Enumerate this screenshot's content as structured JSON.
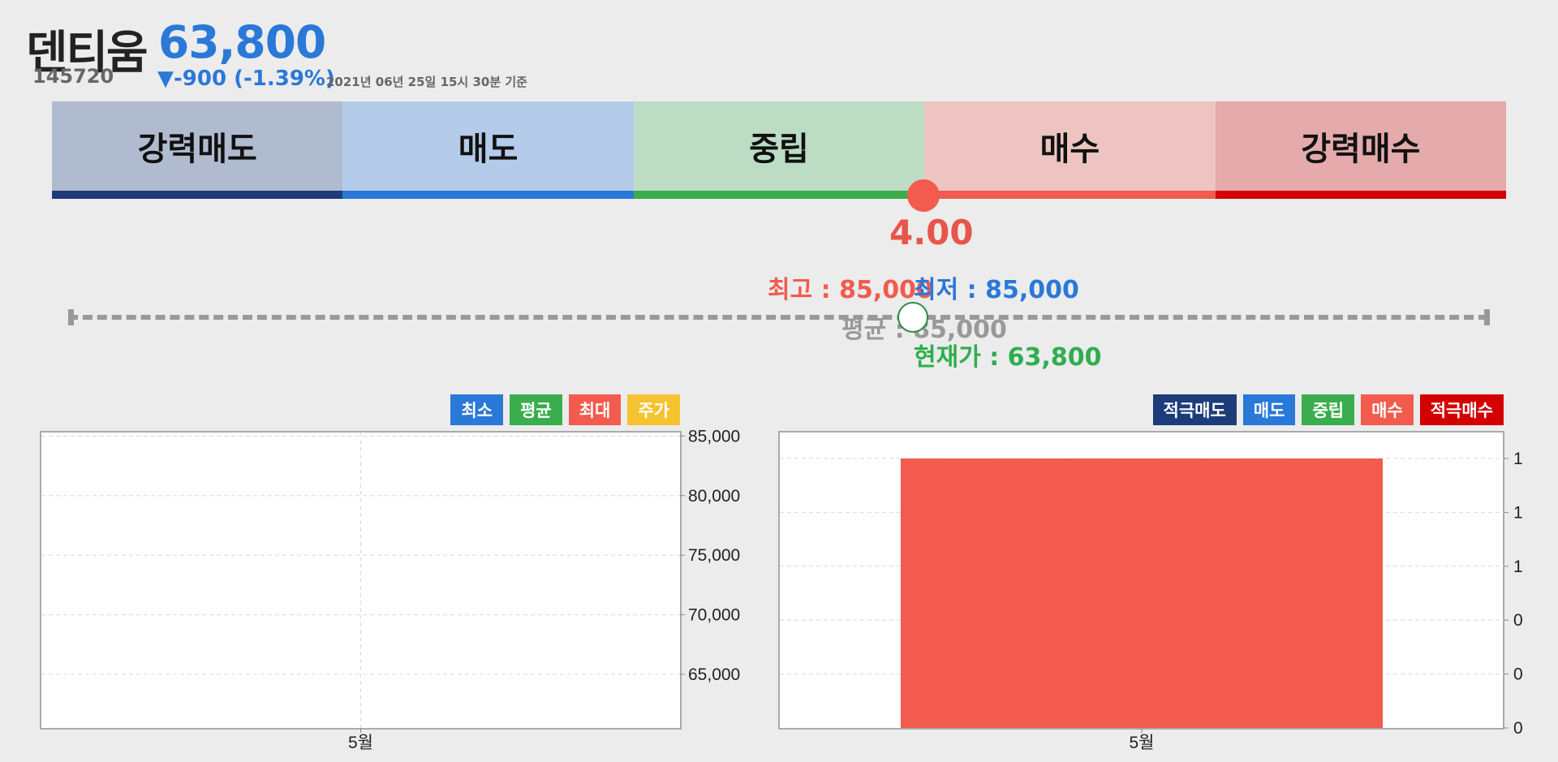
{
  "header": {
    "stock_name": "덴티움",
    "stock_code": "145720",
    "price": "63,800",
    "change": "▼-900 (-1.39%)",
    "date": "2021년 06년 25일 15시 30분 기준"
  },
  "gauge": {
    "segments": [
      {
        "label": "강력매도",
        "bg": "#b1bbd0",
        "bar": "#1d3c7a"
      },
      {
        "label": "매도",
        "bg": "#b5cbea",
        "bar": "#2a78d8"
      },
      {
        "label": "중립",
        "bg": "#bddcc4",
        "bar": "#3aae4c"
      },
      {
        "label": "매수",
        "bg": "#edc4c1",
        "bar": "#f25b4d"
      },
      {
        "label": "강력매수",
        "bg": "#e5aaab",
        "bar": "#d40000"
      }
    ],
    "score": "4.00"
  },
  "price_range": {
    "high": "최고 : 85,000",
    "low": "최저 : 85,000",
    "avg": "평균 : 85,000",
    "current": "현재가 : 63,800"
  },
  "colors": {
    "blue": "#2a78d8",
    "green": "#3aae4c",
    "red": "#f25b4d",
    "yellow": "#f6c330",
    "navy": "#1d3c7a",
    "dark_red": "#d40000"
  },
  "legend_left": [
    {
      "label": "최소",
      "color": "#2a78d8"
    },
    {
      "label": "평균",
      "color": "#3aae4c"
    },
    {
      "label": "최대",
      "color": "#f25b4d"
    },
    {
      "label": "주가",
      "color": "#f6c330"
    }
  ],
  "legend_right": [
    {
      "label": "적극매도",
      "color": "#1d3c7a"
    },
    {
      "label": "매도",
      "color": "#2a78d8"
    },
    {
      "label": "중립",
      "color": "#3aae4c"
    },
    {
      "label": "매수",
      "color": "#f25b4d"
    },
    {
      "label": "적극매수",
      "color": "#d40000"
    }
  ],
  "chart_data": [
    {
      "type": "line",
      "categories": [
        "5월"
      ],
      "series": [],
      "yticks": [
        65000,
        70000,
        75000,
        80000,
        85000
      ],
      "ytick_labels": [
        "65,000",
        "70,000",
        "75,000",
        "80,000",
        "85,000"
      ],
      "ylim": [
        60500,
        85300
      ],
      "grid": true
    },
    {
      "type": "bar",
      "categories": [
        "5월"
      ],
      "series": [
        {
          "name": "매수",
          "values": [
            1
          ]
        }
      ],
      "ytick_labels": [
        "0",
        "0",
        "0",
        "1",
        "1",
        "1"
      ],
      "ylim": [
        0,
        1
      ],
      "grid": true
    }
  ]
}
